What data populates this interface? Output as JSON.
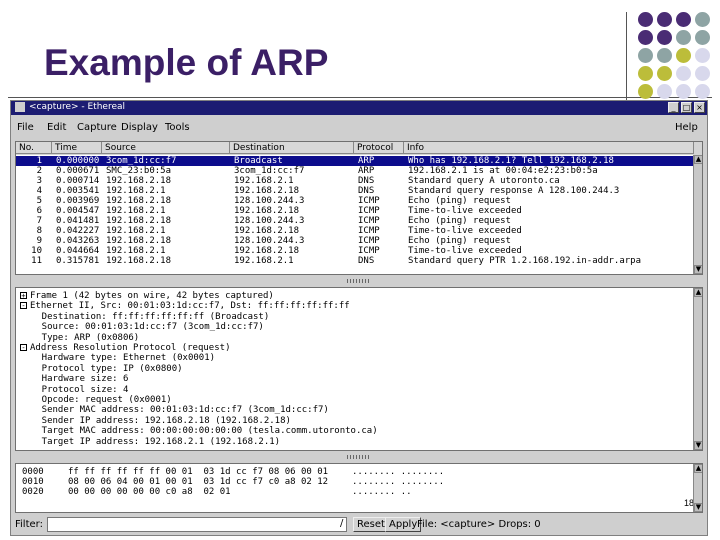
{
  "slide": {
    "title": "Example of ARP",
    "page_number": "18"
  },
  "window": {
    "title": "<capture> - Ethereal"
  },
  "menu": [
    "File",
    "Edit",
    "Capture",
    "Display",
    "Tools",
    "Help"
  ],
  "packet_list": {
    "columns": [
      "No.",
      "Time",
      "Source",
      "Destination",
      "Protocol",
      "Info"
    ],
    "rows": [
      [
        "1",
        "0.000000",
        "3com_1d:cc:f7",
        "Broadcast",
        "ARP",
        "Who has 192.168.2.1?  Tell 192.168.2.18"
      ],
      [
        "2",
        "0.000671",
        "SMC_23:b0:5a",
        "3com_1d:cc:f7",
        "ARP",
        "192.168.2.1 is at 00:04:e2:23:b0:5a"
      ],
      [
        "3",
        "0.000714",
        "192.168.2.18",
        "192.168.2.1",
        "DNS",
        "Standard query A utoronto.ca"
      ],
      [
        "4",
        "0.003541",
        "192.168.2.1",
        "192.168.2.18",
        "DNS",
        "Standard query response A 128.100.244.3"
      ],
      [
        "5",
        "0.003969",
        "192.168.2.18",
        "128.100.244.3",
        "ICMP",
        "Echo (ping) request"
      ],
      [
        "6",
        "0.004547",
        "192.168.2.1",
        "192.168.2.18",
        "ICMP",
        "Time-to-live exceeded"
      ],
      [
        "7",
        "0.041481",
        "192.168.2.18",
        "128.100.244.3",
        "ICMP",
        "Echo (ping) request"
      ],
      [
        "8",
        "0.042227",
        "192.168.2.1",
        "192.168.2.18",
        "ICMP",
        "Time-to-live exceeded"
      ],
      [
        "9",
        "0.043263",
        "192.168.2.18",
        "128.100.244.3",
        "ICMP",
        "Echo (ping) request"
      ],
      [
        "10",
        "0.044664",
        "192.168.2.1",
        "192.168.2.18",
        "ICMP",
        "Time-to-live exceeded"
      ],
      [
        "11",
        "0.315781",
        "192.168.2.18",
        "192.168.2.1",
        "DNS",
        "Standard query PTR 1.2.168.192.in-addr.arpa"
      ]
    ]
  },
  "detail": [
    {
      "marker": "+",
      "text": "Frame 1 (42 bytes on wire, 42 bytes captured)"
    },
    {
      "marker": "-",
      "text": "Ethernet II, Src: 00:01:03:1d:cc:f7, Dst: ff:ff:ff:ff:ff:ff"
    },
    {
      "marker": "",
      "text": "    Destination: ff:ff:ff:ff:ff:ff (Broadcast)"
    },
    {
      "marker": "",
      "text": "    Source: 00:01:03:1d:cc:f7 (3com_1d:cc:f7)"
    },
    {
      "marker": "",
      "text": "    Type: ARP (0x0806)"
    },
    {
      "marker": "-",
      "text": "Address Resolution Protocol (request)"
    },
    {
      "marker": "",
      "text": "    Hardware type: Ethernet (0x0001)"
    },
    {
      "marker": "",
      "text": "    Protocol type: IP (0x0800)"
    },
    {
      "marker": "",
      "text": "    Hardware size: 6"
    },
    {
      "marker": "",
      "text": "    Protocol size: 4"
    },
    {
      "marker": "",
      "text": "    Opcode: request (0x0001)"
    },
    {
      "marker": "",
      "text": "    Sender MAC address: 00:01:03:1d:cc:f7 (3com_1d:cc:f7)"
    },
    {
      "marker": "",
      "text": "    Sender IP address: 192.168.2.18 (192.168.2.18)"
    },
    {
      "marker": "",
      "text": "    Target MAC address: 00:00:00:00:00:00 (tesla.comm.utoronto.ca)"
    },
    {
      "marker": "",
      "text": "    Target IP address: 192.168.2.1 (192.168.2.1)"
    }
  ],
  "hex": [
    {
      "offset": "0000",
      "bytes": "ff ff ff ff ff ff 00 01  03 1d cc f7 08 06 00 01",
      "ascii": "........ ........"
    },
    {
      "offset": "0010",
      "bytes": "08 00 06 04 00 01 00 01  03 1d cc f7 c0 a8 02 12",
      "ascii": "........ ........"
    },
    {
      "offset": "0020",
      "bytes": "00 00 00 00 00 00 c0 a8  02 01",
      "ascii": "........ .."
    }
  ],
  "statusbar": {
    "filter_label": "Filter:",
    "filter_value": "",
    "reset_label": "Reset",
    "apply_label": "Apply",
    "status_text": "File: <capture>  Drops: 0"
  },
  "colors": {
    "title": "#3b1f66",
    "titlebar": "#1c1c72",
    "selection": "#0c0c8c",
    "dot_purple": "#4a2c74",
    "dot_teal": "#8ea4a4",
    "dot_olive": "#bcbd3a",
    "dot_light": "#d8d8ec"
  }
}
